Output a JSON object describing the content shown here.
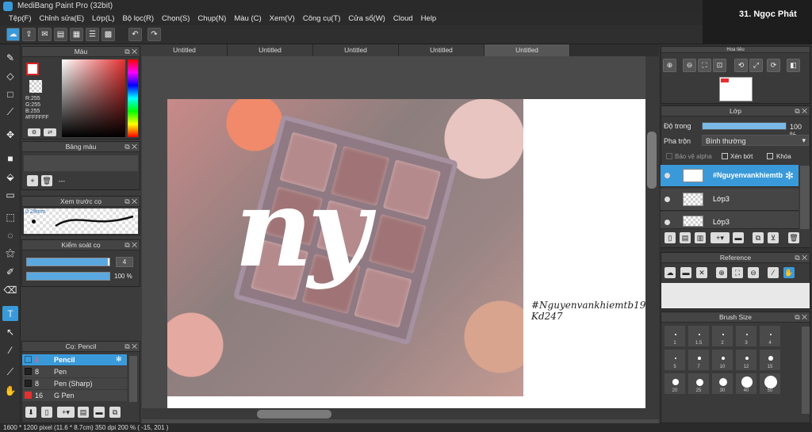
{
  "window": {
    "title": "MediBang Paint Pro (32bit)"
  },
  "menu": [
    "Tệp(F)",
    "Chỉnh sửa(E)",
    "Lớp(L)",
    "Bộ lọc(R)",
    "Chọn(S)",
    "Chụp(N)",
    "Màu (C)",
    "Xem(V)",
    "Công cụ(T)",
    "Cửa sổ(W)",
    "Cloud",
    "Help"
  ],
  "overlay_label": "31. Ngọc Phát",
  "tabs": [
    "Untitled",
    "Untitled",
    "Untitled",
    "Untitled",
    "Untitled"
  ],
  "color_panel": {
    "title": "Màu",
    "r": "R:255",
    "g": "G:255",
    "b": "B:255",
    "hex": "#FFFFFF",
    "primary_color": "#ffffff",
    "secondary_color": "#ff0000"
  },
  "palette_panel": {
    "title": "Bảng màu",
    "empty_label": "---"
  },
  "brush_preview": {
    "title": "Xem trước cọ",
    "size": "0.29mm"
  },
  "brush_control": {
    "title": "Kiểm soát cọ",
    "size_value": "4",
    "opacity_value": "100 %",
    "size_fraction": 0.98,
    "opacity_fraction": 1.0
  },
  "brush_list": {
    "title": "Cọ: Pencil",
    "items": [
      {
        "size": "4",
        "name": "Pencil",
        "color": "#3a9ad9"
      },
      {
        "size": "8",
        "name": "Pen",
        "color": "#222222"
      },
      {
        "size": "8",
        "name": "Pen (Sharp)",
        "color": "#222222"
      },
      {
        "size": "16",
        "name": "G Pen",
        "color": "#e03030"
      }
    ]
  },
  "canvas": {
    "photo_text": "ny",
    "signature_line1": "#Nguyenvankhiemtb1983",
    "signature_line2": "Kd247"
  },
  "navigator": {
    "title": "Hoa tiêu"
  },
  "layers": {
    "title": "Lớp",
    "opacity_label": "Độ trong",
    "opacity_value": "100 %",
    "blend_label": "Pha trộn",
    "blend_value": "Bình thường",
    "protect_alpha": "Bảo vệ alpha",
    "clipping": "Xén bớt",
    "lock": "Khóa",
    "items": [
      {
        "name": "#Nguyenvankhiemtb",
        "active": true
      },
      {
        "name": "Lớp3",
        "active": false
      },
      {
        "name": "Lớp3",
        "active": false
      }
    ]
  },
  "reference": {
    "title": "Reference"
  },
  "brush_size": {
    "title": "Brush Size",
    "sizes": [
      "1",
      "1.5",
      "2",
      "3",
      "4",
      "5",
      "7",
      "10",
      "12",
      "15",
      "20",
      "25",
      "30",
      "40",
      "50"
    ]
  },
  "status": {
    "text": "1600 * 1200 pixel   (11.6 * 8.7cm)   350 dpi   200 %   ( -15, 201 )"
  }
}
